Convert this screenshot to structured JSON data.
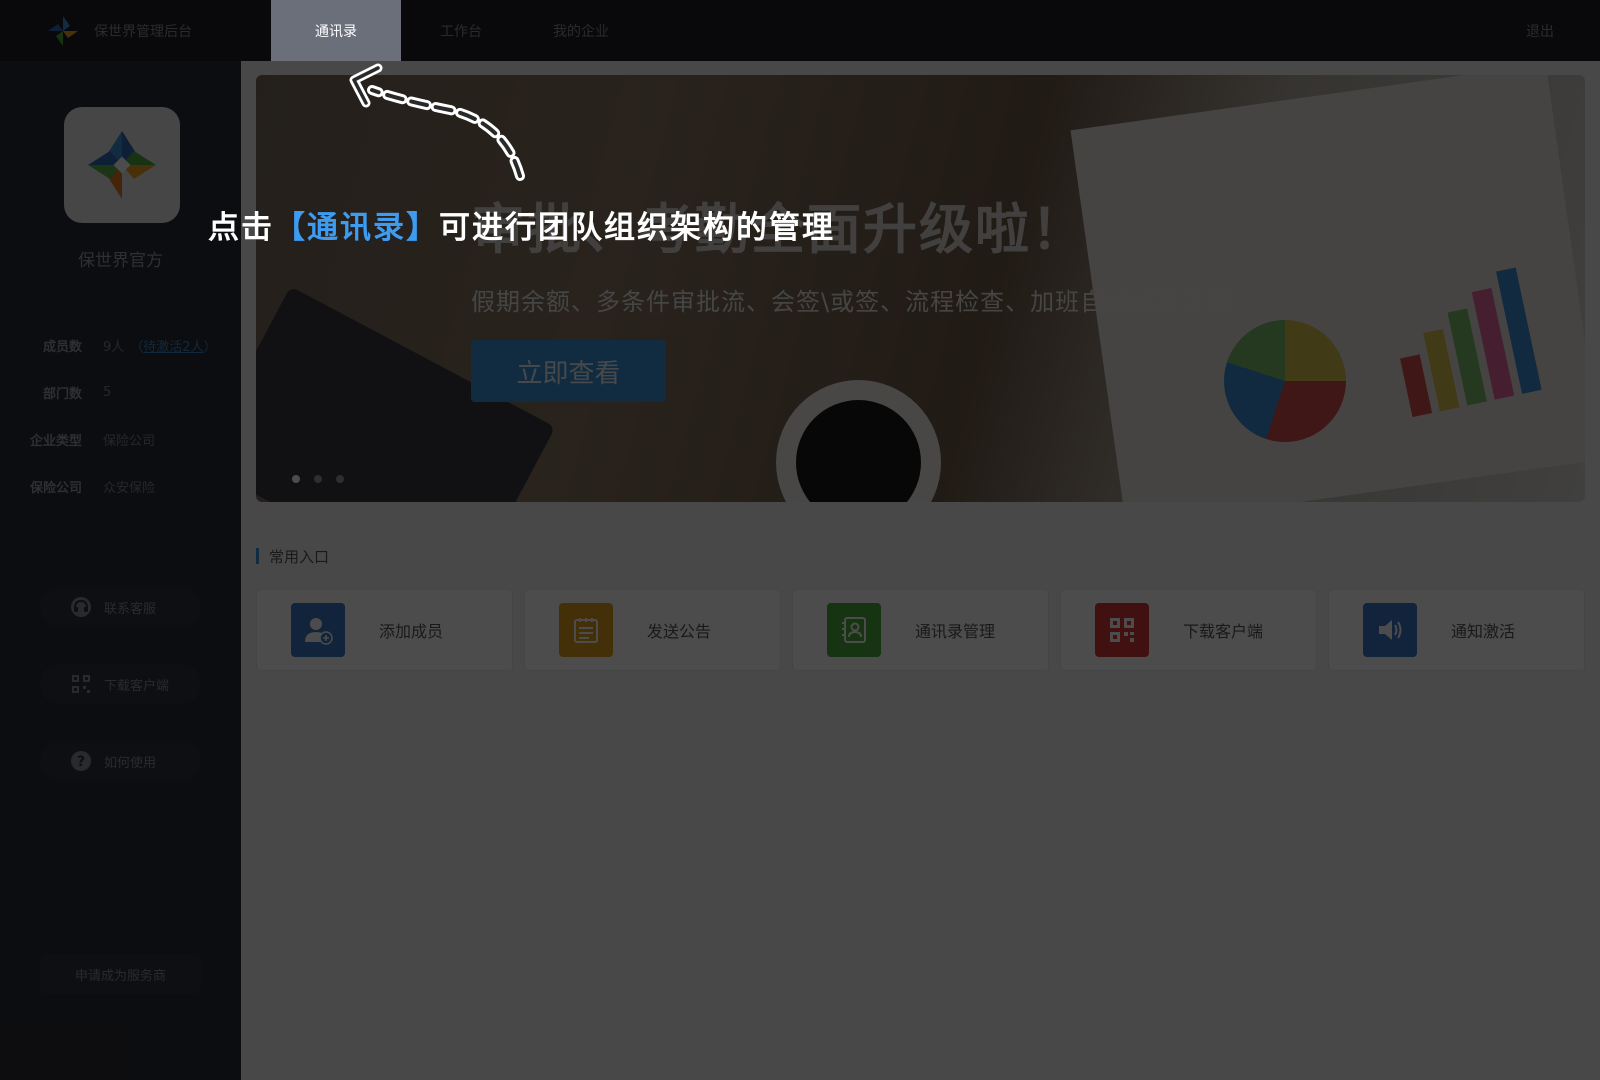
{
  "header": {
    "app_title": "保世界管理后台",
    "tabs": [
      {
        "label": "通讯录",
        "active": true
      },
      {
        "label": "工作台",
        "active": false
      },
      {
        "label": "我的企业",
        "active": false
      }
    ],
    "logout_label": "退出"
  },
  "sidebar": {
    "org_name": "保世界官方",
    "stats": [
      {
        "label": "成员数",
        "value": "9人"
      },
      {
        "label": "部门数",
        "value": "5"
      },
      {
        "label": "企业类型",
        "value": "保险公司"
      },
      {
        "label": "保险公司",
        "value": "众安保险"
      }
    ],
    "pending_paren_open": "（",
    "pending_link": "待激活2人",
    "pending_paren_close": "）",
    "buttons": [
      {
        "label": "联系客服",
        "icon": "headset-icon"
      },
      {
        "label": "下载客户端",
        "icon": "qr-code-icon"
      },
      {
        "label": "如何使用",
        "icon": "question-icon"
      }
    ],
    "apply_label": "申请成为服务商"
  },
  "banner": {
    "title": "审批、考勤全面升级啦！",
    "subtitle": "假期余额、多条件审批流、会签\\或签、流程检查、加班自动计算工时",
    "button_label": "立即查看",
    "slide_count": 3,
    "active_slide": 0
  },
  "quick": {
    "section_title": "常用入口",
    "items": [
      {
        "label": "添加成员",
        "icon": "add-member-icon",
        "color": "#3b78c8"
      },
      {
        "label": "发送公告",
        "icon": "notice-icon",
        "color": "#e4a21b"
      },
      {
        "label": "通讯录管理",
        "icon": "contacts-icon",
        "color": "#4caa3c"
      },
      {
        "label": "下载客户端",
        "icon": "qr-code-icon",
        "color": "#d93a3a"
      },
      {
        "label": "通知激活",
        "icon": "speaker-icon",
        "color": "#3b78c8"
      }
    ]
  },
  "guide": {
    "text_before": "点击",
    "text_highlight": "【通讯录】",
    "text_after": "可进行团队组织架构的管理",
    "highlight_color": "#3d9bf0",
    "overlay_color": "rgba(0,0,0,0.70)"
  }
}
